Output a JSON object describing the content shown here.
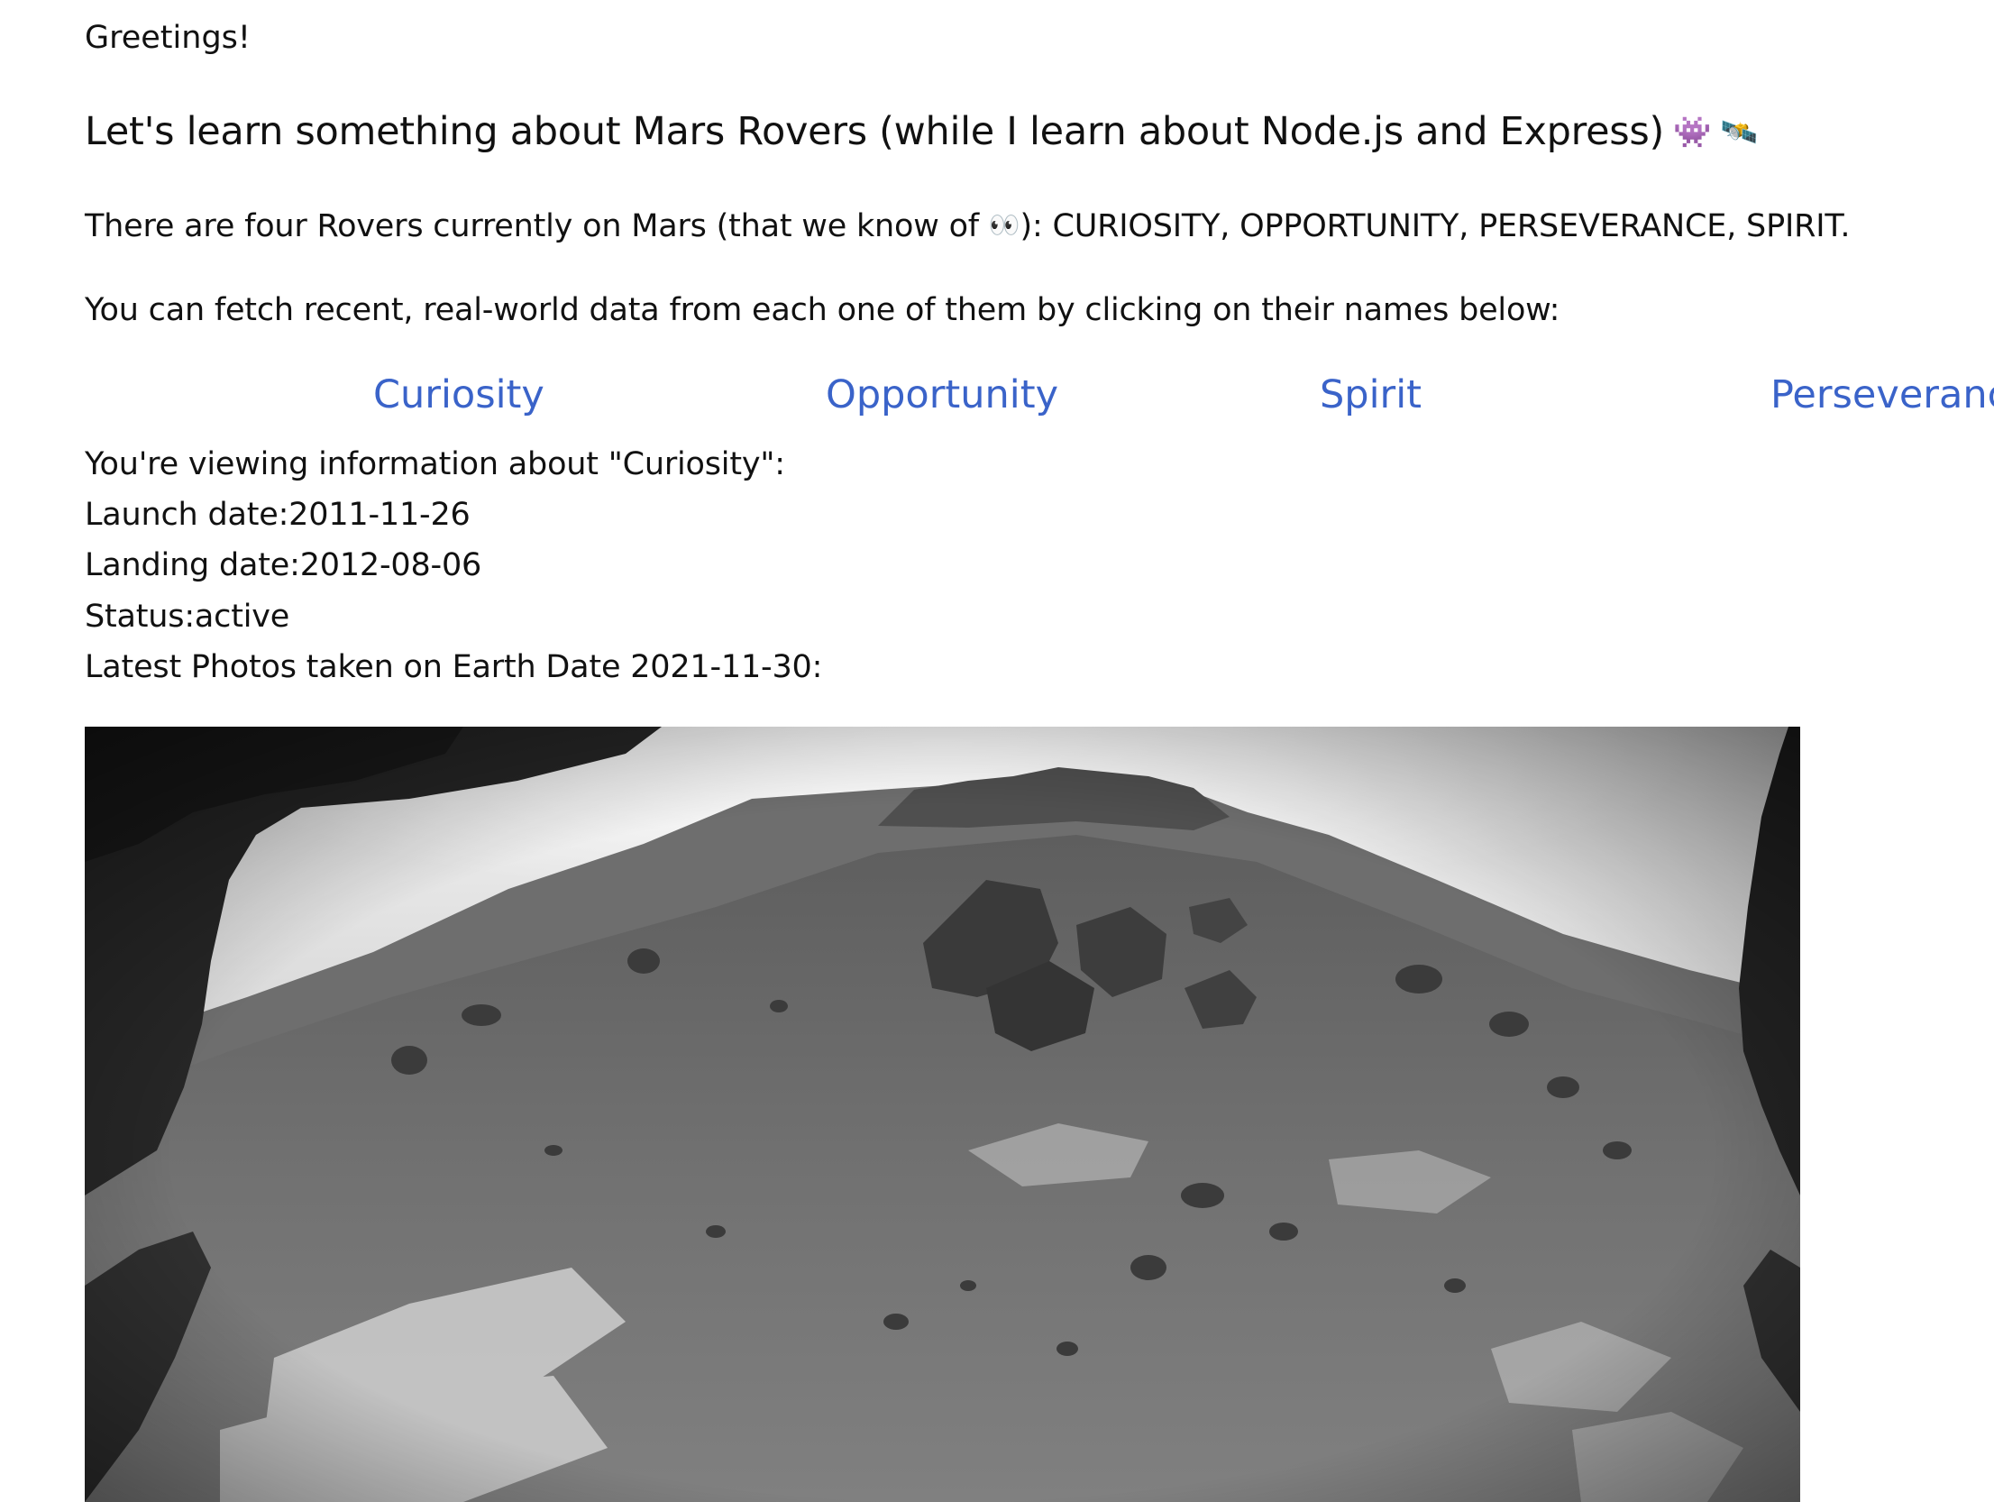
{
  "greeting": "Greetings!",
  "title": "Let's learn something about Mars Rovers (while I learn about Node.js and Express)",
  "title_icons": [
    "alien-monster-icon",
    "satellite-icon"
  ],
  "rovers_text": {
    "before": "There are four Rovers currently on Mars (that we know of ",
    "after": "): CURIOSITY, OPPORTUNITY, PERSEVERANCE, SPIRIT."
  },
  "fetch_text": "You can fetch recent, real-world data from each one of them by clicking on their names below:",
  "nav": {
    "links": [
      "Curiosity",
      "Opportunity",
      "Spirit",
      "Perseverance"
    ],
    "link_color": "#3a63c9"
  },
  "info": {
    "viewing": "You're viewing information about \"Curiosity\":",
    "launch": "Launch date:2011-11-26",
    "landing": "Landing date:2012-08-06",
    "status": "Status:active",
    "photos": "Latest Photos taken on Earth Date 2021-11-30:"
  },
  "photo": {
    "description_icon": "mars-rover-photo"
  }
}
